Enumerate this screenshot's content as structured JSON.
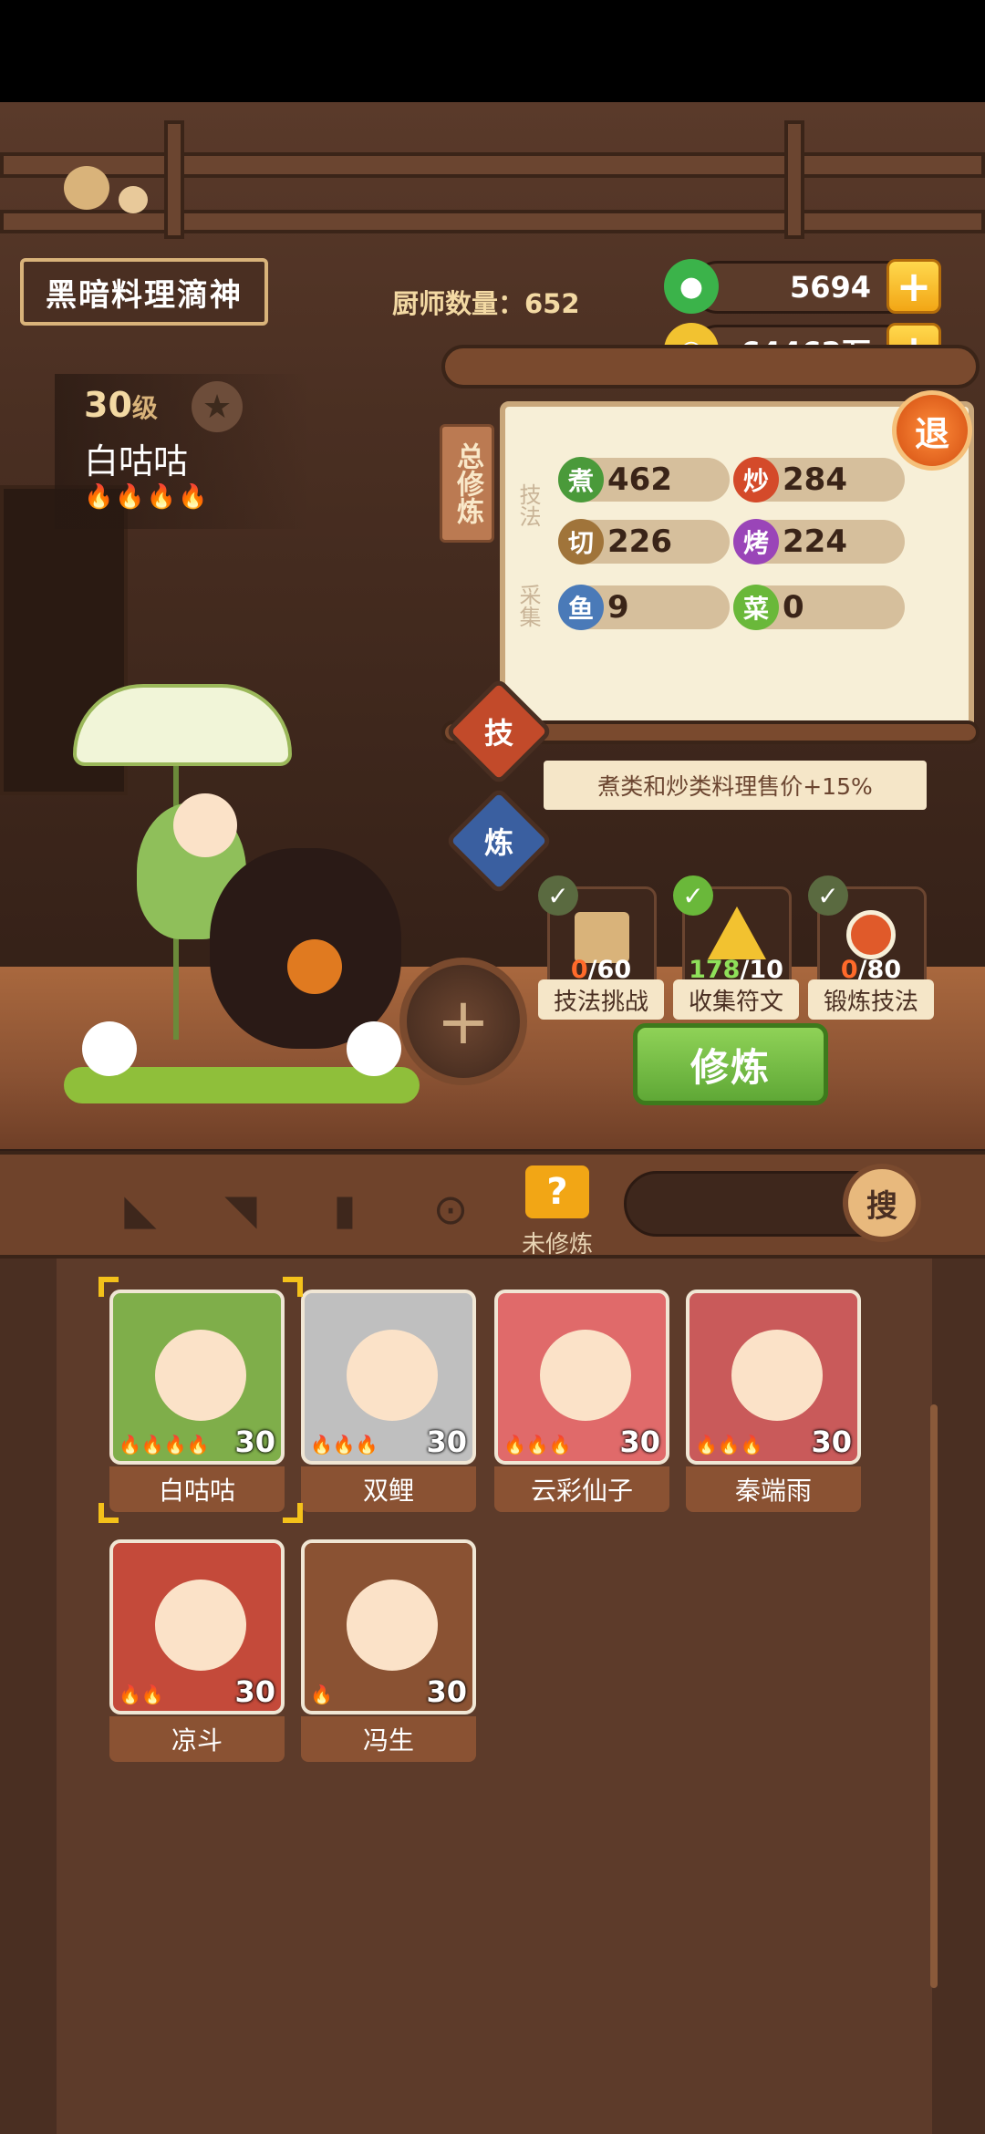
{
  "player": {
    "title": "黑暗料理滴神",
    "chef_count": "厨师数量：652"
  },
  "resources": [
    {
      "name": "jade",
      "value": "5694",
      "color": "#3bb34a"
    },
    {
      "name": "coins",
      "value": "64462万",
      "color": "#f2c230"
    }
  ],
  "chef": {
    "level_num": "30",
    "level_unit": "级",
    "name": "白咕咕",
    "flames": "🔥🔥🔥🔥"
  },
  "stats": {
    "tag": "总修炼",
    "skill_label": "技法",
    "gather_label": "采集",
    "items": [
      {
        "icon": "煮",
        "value": "462",
        "color": "#4a9a3a"
      },
      {
        "icon": "炒",
        "value": "284",
        "color": "#d44a2a"
      },
      {
        "icon": "切",
        "value": "226",
        "color": "#a0743a"
      },
      {
        "icon": "烤",
        "value": "224",
        "color": "#9a45b8"
      },
      {
        "icon": "鱼",
        "value": "9",
        "color": "#4a7ab8"
      },
      {
        "icon": "菜",
        "value": "0",
        "color": "#6ab83a"
      }
    ]
  },
  "exit_label": "退",
  "side_buttons": {
    "skill": "技",
    "refine": "炼"
  },
  "bonus_text": "煮类和炒类料理售价+15%",
  "tasks": [
    {
      "label": "技法挑战",
      "cur": "0",
      "total": "/60",
      "cur_color": "#ff6a2a"
    },
    {
      "label": "收集符文",
      "cur": "178",
      "total": "/10",
      "cur_color": "#8fe05a"
    },
    {
      "label": "锻炼技法",
      "cur": "0",
      "total": "/80",
      "cur_color": "#ff6a2a"
    }
  ],
  "train_label": "修炼",
  "add_label": "+",
  "tabs": {
    "active_label": "未修炼",
    "search_label": "搜"
  },
  "cards": [
    {
      "name": "白咕咕",
      "level": "30",
      "flames": "🔥🔥🔥🔥",
      "bg": "#7fae4a"
    },
    {
      "name": "双鲤",
      "level": "30",
      "flames": "🔥🔥🔥",
      "bg": "#bfbfbf"
    },
    {
      "name": "云彩仙子",
      "level": "30",
      "flames": "🔥🔥🔥",
      "bg": "#e06a6a"
    },
    {
      "name": "秦端雨",
      "level": "30",
      "flames": "🔥🔥🔥",
      "bg": "#c95a5a"
    },
    {
      "name": "凉斗",
      "level": "30",
      "flames": "🔥🔥",
      "bg": "#c44a3a"
    },
    {
      "name": "冯生",
      "level": "30",
      "flames": "🔥",
      "bg": "#8a5233"
    }
  ]
}
